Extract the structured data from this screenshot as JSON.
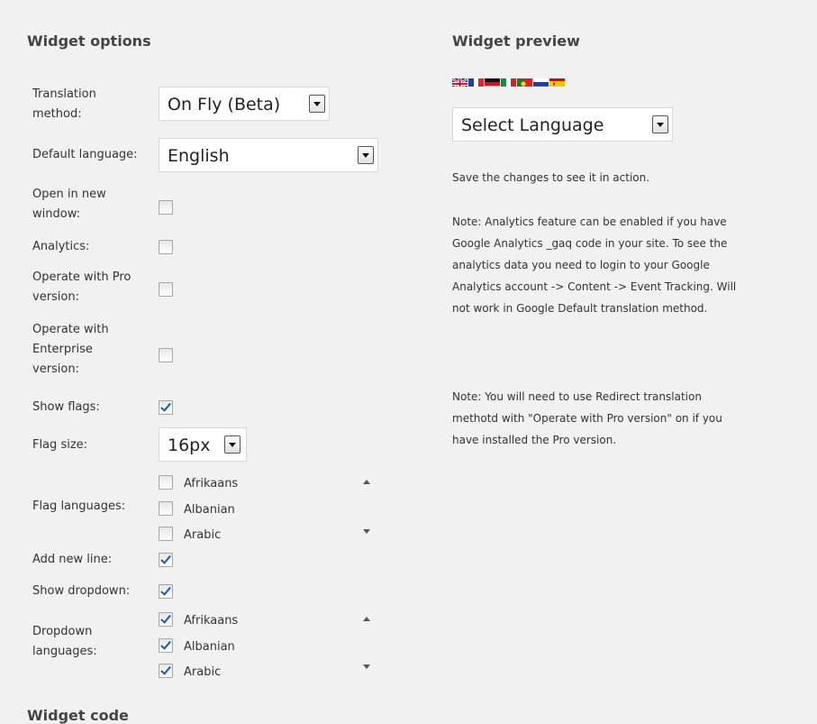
{
  "options": {
    "heading": "Widget options",
    "translation_method": {
      "label_line1": "Translation",
      "label_line2": "method:",
      "value": "On Fly (Beta)"
    },
    "default_language": {
      "label": "Default language:",
      "value": "English"
    },
    "open_new_window": {
      "label_line1": "Open in new",
      "label_line2": "window:",
      "checked": false
    },
    "analytics": {
      "label": "Analytics:",
      "checked": false
    },
    "operate_pro": {
      "label_line1": "Operate with Pro",
      "label_line2": "version:",
      "checked": false
    },
    "operate_enterprise": {
      "label_line1": "Operate with",
      "label_line2": "Enterprise",
      "label_line3": "version:",
      "checked": false
    },
    "show_flags": {
      "label": "Show flags:",
      "checked": true
    },
    "flag_size": {
      "label": "Flag size:",
      "value": "16px"
    },
    "flag_languages": {
      "label": "Flag languages:",
      "items": [
        {
          "name": "Afrikaans",
          "checked": false
        },
        {
          "name": "Albanian",
          "checked": false
        },
        {
          "name": "Arabic",
          "checked": false
        }
      ]
    },
    "add_new_line": {
      "label": "Add new line:",
      "checked": true
    },
    "show_dropdown": {
      "label": "Show dropdown:",
      "checked": true
    },
    "dropdown_languages": {
      "label_line1": "Dropdown",
      "label_line2": "languages:",
      "items": [
        {
          "name": "Afrikaans",
          "checked": true
        },
        {
          "name": "Albanian",
          "checked": true
        },
        {
          "name": "Arabic",
          "checked": true
        }
      ]
    },
    "next_heading_cut": "Widget code"
  },
  "preview": {
    "heading": "Widget preview",
    "flags": [
      "uk-flag-icon",
      "france-flag-icon",
      "germany-flag-icon",
      "italy-flag-icon",
      "portugal-flag-icon",
      "russia-flag-icon",
      "spain-flag-icon"
    ],
    "select_language": "Select Language",
    "save_note": "Save the changes to see it in action.",
    "analytics_note": "Note: Analytics feature can be enabled if you have Google Analytics _gaq code in your site. To see the analytics data you need to login to your Google Analytics account -> Content -> Event Tracking. Will not work in Google Default translation method.",
    "redirect_note": "Note: You will need to use Redirect translation methotd with \"Operate with Pro version\" on if you have installed the Pro version."
  },
  "colors": {
    "background": "#f1f1f1",
    "check": "#1e5aa8",
    "heading": "#444444"
  }
}
